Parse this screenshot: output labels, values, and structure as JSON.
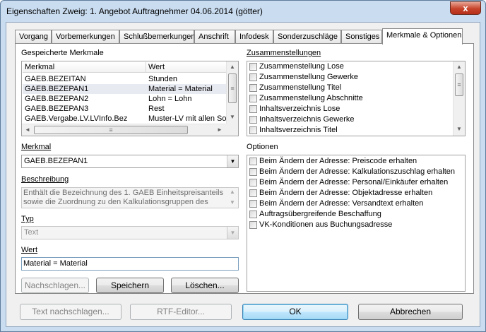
{
  "window": {
    "title": "Eigenschaften Zweig: 1. Angebot Auftragnehmer 04.06.2014 (götter)",
    "close_glyph": "x"
  },
  "tabs": [
    {
      "label": "Vorgang"
    },
    {
      "label": "Vorbemerkungen"
    },
    {
      "label": "Schlußbemerkungen"
    },
    {
      "label": "Anschrift"
    },
    {
      "label": "Infodesk"
    },
    {
      "label": "Sonderzuschläge"
    },
    {
      "label": "Sonstiges"
    },
    {
      "label": "Merkmale & Optionen",
      "active": true
    }
  ],
  "gespeicherte": {
    "label": "Gespeicherte Merkmale",
    "columns": [
      "Merkmal",
      "Wert"
    ],
    "rows": [
      {
        "merkmal": "GAEB.BEZEITAN",
        "wert": "Stunden"
      },
      {
        "merkmal": "GAEB.BEZEPAN1",
        "wert": "Material = Material",
        "selected": true
      },
      {
        "merkmal": "GAEB.BEZEPAN2",
        "wert": "Lohn = Lohn"
      },
      {
        "merkmal": "GAEB.BEZEPAN3",
        "wert": "Rest"
      },
      {
        "merkmal": "GAEB.Vergabe.LV.LVInfo.Bez",
        "wert": "Muster-LV mit allen Son"
      }
    ]
  },
  "merkmal": {
    "label": "Merkmal",
    "value": "GAEB.BEZEPAN1"
  },
  "beschreibung": {
    "label": "Beschreibung",
    "line1": "Enthält die Bezeichnung des 1. GAEB Einheitspreisanteils",
    "line2": "sowie die Zuordnung zu den Kalkulationsgruppen des"
  },
  "typ": {
    "label": "Typ",
    "value": "Text"
  },
  "wert": {
    "label": "Wert",
    "value": "Material = Material"
  },
  "buttons": {
    "nachschlagen": "Nachschlagen...",
    "speichern": "Speichern",
    "loeschen": "Löschen...",
    "text_nachschlagen": "Text nachschlagen...",
    "rtf_editor": "RTF-Editor...",
    "ok": "OK",
    "abbrechen": "Abbrechen"
  },
  "zusammenstellungen": {
    "label": "Zusammenstellungen",
    "items": [
      "Zusammenstellung Lose",
      "Zusammenstellung Gewerke",
      "Zusammenstellung Titel",
      "Zusammenstellung Abschnitte",
      "Inhaltsverzeichnis Lose",
      "Inhaltsverzeichnis Gewerke",
      "Inhaltsverzeichnis Titel"
    ]
  },
  "optionen": {
    "label": "Optionen",
    "items": [
      "Beim Ändern der Adresse: Preiscode erhalten",
      "Beim Ändern der Adresse: Kalkulationszuschlag erhalten",
      "Beim Ändern der Adresse: Personal/Einkäufer erhalten",
      "Beim Ändern der Adresse: Objektadresse erhalten",
      "Beim Ändern der Adresse: Versandtext erhalten",
      "Auftragsübergreifende Beschaffung",
      "VK-Konditionen aus Buchungsadresse"
    ]
  },
  "icons": {
    "scroll_up": "▲",
    "scroll_down": "▼",
    "scroll_left": "◄",
    "scroll_right": "►",
    "dropdown": "▼",
    "thumb_grip": "≡"
  }
}
